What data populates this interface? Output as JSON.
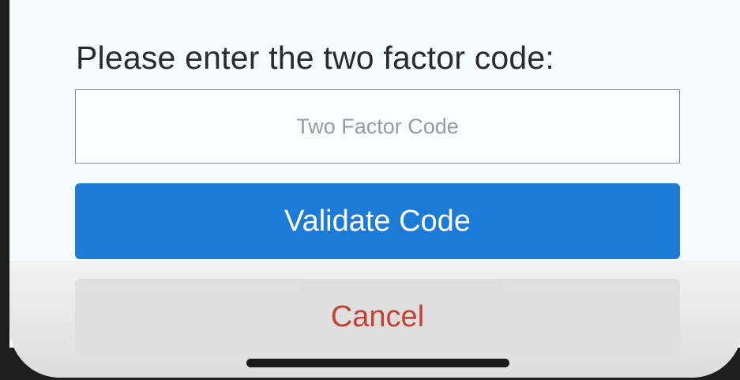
{
  "dialog": {
    "prompt": "Please enter the two factor code:",
    "code_input": {
      "value": "",
      "placeholder": "Two Factor Code"
    },
    "validate_label": "Validate Code",
    "cancel_label": "Cancel"
  },
  "colors": {
    "primary": "#1d7bd8",
    "danger_text": "#c0392b",
    "screen_background": "#f4fbff"
  }
}
